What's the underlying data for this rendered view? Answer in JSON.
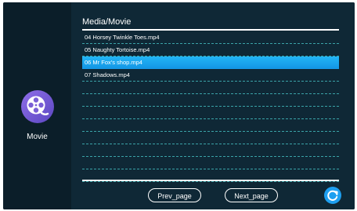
{
  "sidebar": {
    "icon": "film-reel-icon",
    "label": "Movie"
  },
  "header": {
    "title": "Media/Movie"
  },
  "files": [
    {
      "name": "04 Horsey Twinkle Toes.mp4",
      "selected": false
    },
    {
      "name": "05 Naughty Tortoise.mp4",
      "selected": false
    },
    {
      "name": "06 Mr Fox's shop.mp4",
      "selected": true
    },
    {
      "name": "07 Shadows.mp4",
      "selected": false
    },
    {
      "name": "",
      "selected": false
    },
    {
      "name": "",
      "selected": false
    },
    {
      "name": "",
      "selected": false
    },
    {
      "name": "",
      "selected": false
    },
    {
      "name": "",
      "selected": false
    },
    {
      "name": "",
      "selected": false
    },
    {
      "name": "",
      "selected": false
    },
    {
      "name": "",
      "selected": false
    }
  ],
  "footer": {
    "prev_label": "Prev_page",
    "next_label": "Next_page",
    "refresh_icon": "refresh-icon"
  },
  "colors": {
    "background": "#0f2836",
    "highlight": "#1ea6f0",
    "icon_purple": "#7a5fd6",
    "divider": "#3aa3a8"
  }
}
